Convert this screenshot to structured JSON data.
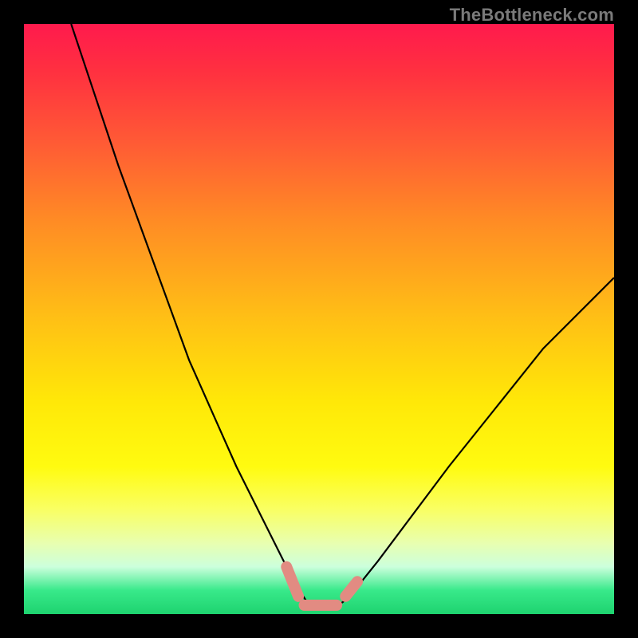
{
  "watermark": "TheBottleneck.com",
  "colors": {
    "frame": "#000000",
    "watermark": "#7a7a7a",
    "curve": "#000000",
    "marker": "#e28b82"
  },
  "chart_data": {
    "type": "line",
    "title": "",
    "xlabel": "",
    "ylabel": "",
    "xlim": [
      0,
      100
    ],
    "ylim": [
      0,
      100
    ],
    "grid": false,
    "legend": false,
    "note": "Bottleneck-style V curve. y = percentage bottleneck (0 at optimum). x = relative component performance. Values estimated from gridless gradient plot.",
    "series": [
      {
        "name": "bottleneck-curve",
        "x": [
          8,
          12,
          16,
          20,
          24,
          28,
          32,
          36,
          40,
          44,
          46,
          48,
          50,
          52,
          54,
          56,
          60,
          66,
          72,
          80,
          88,
          96,
          100
        ],
        "y": [
          100,
          88,
          76,
          65,
          54,
          43,
          34,
          25,
          17,
          9,
          5,
          2,
          1,
          1,
          2,
          4,
          9,
          17,
          25,
          35,
          45,
          53,
          57
        ]
      }
    ],
    "markers": [
      {
        "name": "left-marker",
        "x": [
          44.5,
          46.5
        ],
        "y": [
          8,
          3
        ]
      },
      {
        "name": "bottom-marker",
        "x": [
          47.5,
          53.0
        ],
        "y": [
          1.5,
          1.5
        ]
      },
      {
        "name": "right-marker",
        "x": [
          54.5,
          56.5
        ],
        "y": [
          3,
          5.5
        ]
      }
    ]
  }
}
